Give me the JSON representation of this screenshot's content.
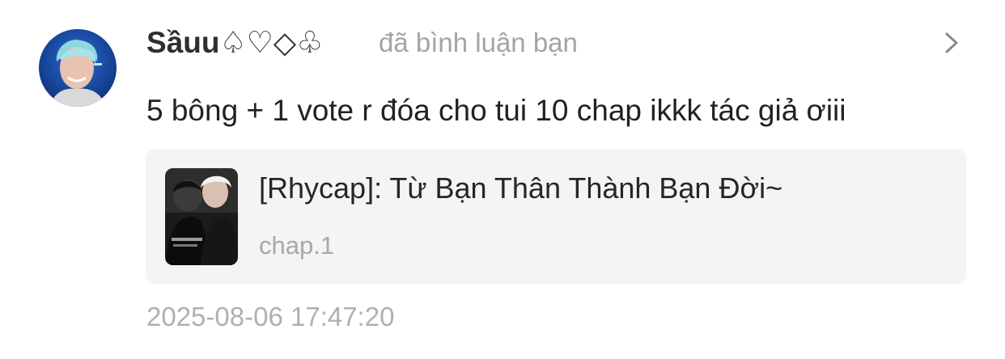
{
  "comment": {
    "username": "Sầuu♤♡◇♧",
    "action_text": "đã bình luận bạn",
    "text": "5 bông + 1 vote r đóa cho tui 10 chap ikkk tác giả ơiii",
    "timestamp": "2025-08-06 17:47:20",
    "avatar_icon": "user-avatar-photo",
    "chevron_icon": "chevron-right-icon"
  },
  "story": {
    "title": "[Rhycap]: Từ Bạn Thân Thành Bạn Đời~",
    "chapter": "chap.1",
    "cover_icon": "story-cover-photo"
  },
  "colors": {
    "background": "#ffffff",
    "username": "#2f2f2f",
    "secondary_text": "#a4a4a4",
    "card_background": "#f4f4f4",
    "avatar_background": "#1d4fa8"
  }
}
